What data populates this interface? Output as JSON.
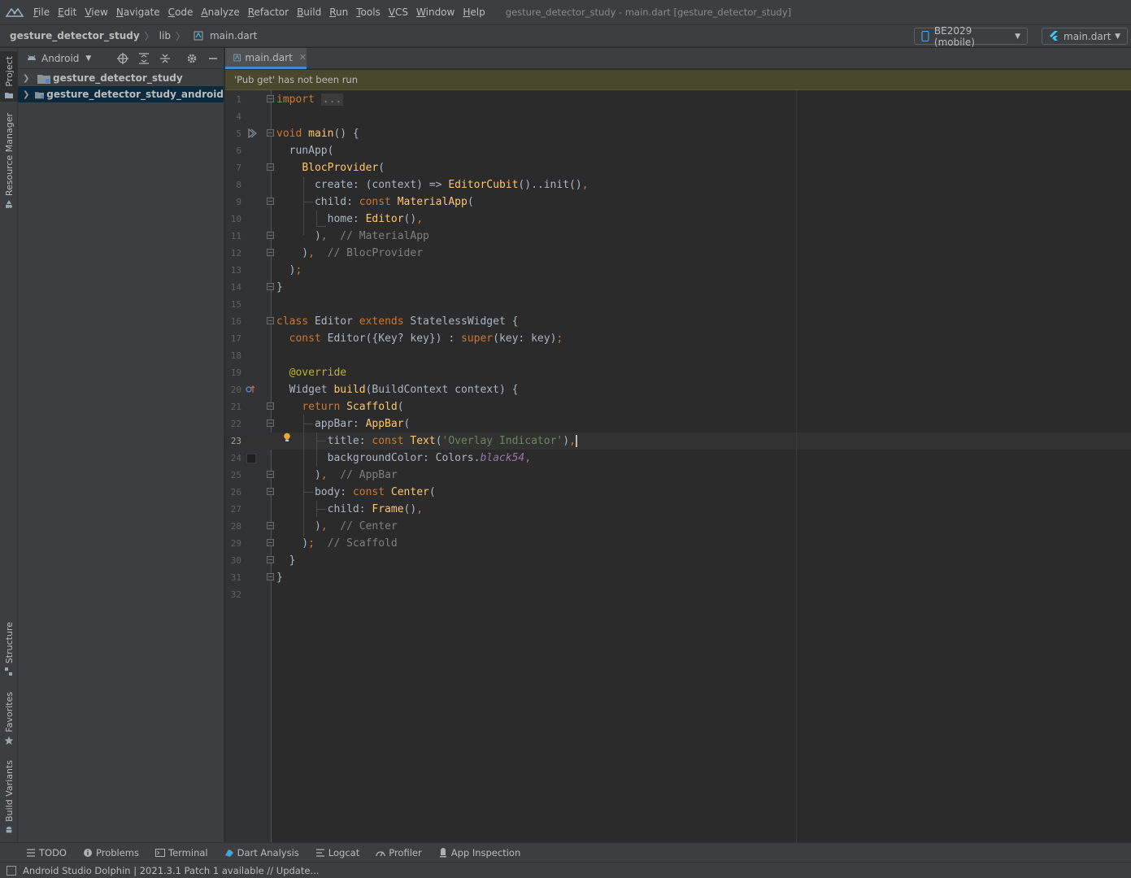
{
  "menu": {
    "items": [
      "File",
      "Edit",
      "View",
      "Navigate",
      "Code",
      "Analyze",
      "Refactor",
      "Build",
      "Run",
      "Tools",
      "VCS",
      "Window",
      "Help"
    ],
    "window_title": "gesture_detector_study - main.dart [gesture_detector_study]"
  },
  "navbar": {
    "project": "gesture_detector_study",
    "folder": "lib",
    "file": "main.dart",
    "device": "BE2029 (mobile)",
    "run_config": "main.dart"
  },
  "left_strip": {
    "project": "Project",
    "resource_manager": "Resource Manager",
    "structure": "Structure",
    "favorites": "Favorites",
    "build_variants": "Build Variants"
  },
  "project_panel": {
    "view_mode": "Android",
    "tree": [
      {
        "label": "gesture_detector_study",
        "selected": false
      },
      {
        "label": "gesture_detector_study_android",
        "selected": true
      }
    ]
  },
  "editor": {
    "tab": "main.dart",
    "banner": "'Pub get' has not been run",
    "line_numbers": [
      "1",
      "4",
      "5",
      "6",
      "7",
      "8",
      "9",
      "10",
      "11",
      "12",
      "13",
      "14",
      "15",
      "16",
      "17",
      "18",
      "19",
      "20",
      "21",
      "22",
      "23",
      "24",
      "25",
      "26",
      "27",
      "28",
      "29",
      "30",
      "31",
      "32"
    ],
    "current_line": "23"
  },
  "bottom_tools": [
    "TODO",
    "Problems",
    "Terminal",
    "Dart Analysis",
    "Logcat",
    "Profiler",
    "App Inspection"
  ],
  "status": {
    "message": "Android Studio Dolphin | 2021.3.1 Patch 1 available // Update..."
  }
}
